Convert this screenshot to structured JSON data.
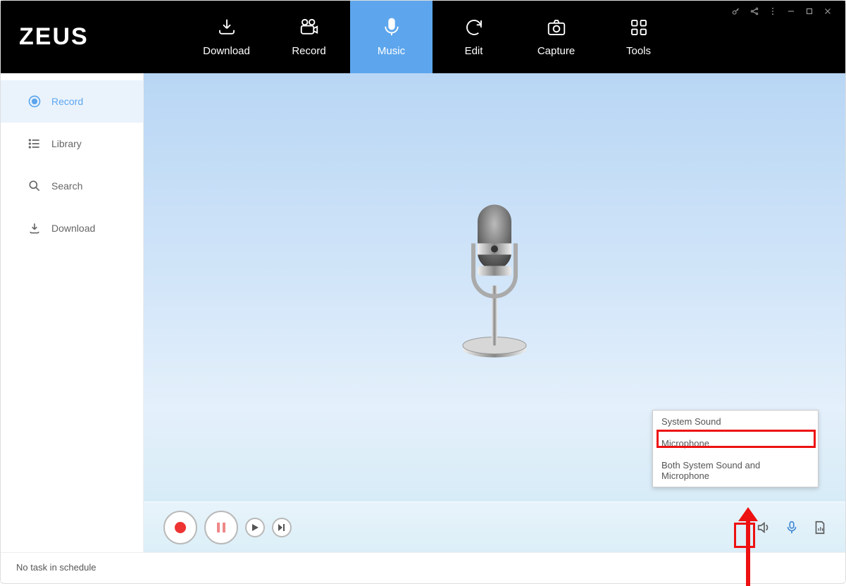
{
  "app": {
    "name": "ZEUS"
  },
  "nav": {
    "items": [
      {
        "label": "Download",
        "icon": "download"
      },
      {
        "label": "Record",
        "icon": "camcorder"
      },
      {
        "label": "Music",
        "icon": "microphone",
        "active": true
      },
      {
        "label": "Edit",
        "icon": "cycle"
      },
      {
        "label": "Capture",
        "icon": "camera"
      },
      {
        "label": "Tools",
        "icon": "grid"
      }
    ]
  },
  "sidebar": {
    "items": [
      {
        "label": "Record",
        "icon": "radio",
        "active": true
      },
      {
        "label": "Library",
        "icon": "list"
      },
      {
        "label": "Search",
        "icon": "search"
      },
      {
        "label": "Download",
        "icon": "download2"
      }
    ]
  },
  "source_menu": {
    "options": [
      "System Sound",
      "Microphone",
      "Both System Sound and Microphone"
    ],
    "selected_index": 0
  },
  "status": {
    "text": "No task in schedule"
  }
}
